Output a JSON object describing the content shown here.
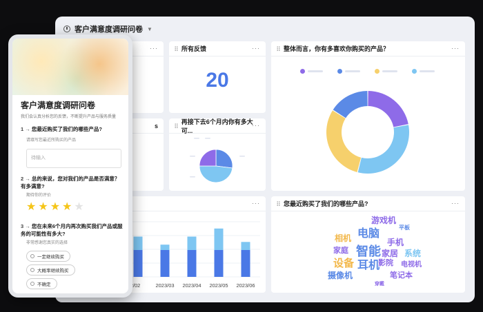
{
  "dashboard": {
    "title": "客户满意度调研问卷",
    "more_label": "···",
    "cards": {
      "partial_top": {
        "title": ""
      },
      "feedback": {
        "title": "所有反馈",
        "value": "20"
      },
      "donut": {
        "title": "整体而言，你有多喜欢你购买的产品？"
      },
      "partial_mid": {
        "title": "s"
      },
      "pie": {
        "title": "再接下去6个月内你有多大可..."
      },
      "bar_chart": {
        "title": ""
      },
      "wordcloud": {
        "title": "您最近购买了我们的哪些产品?"
      }
    }
  },
  "colors": {
    "purple": "#8e6be8",
    "blue": "#5b8ae6",
    "light_blue": "#7ec6f2",
    "yellow": "#f6d06c",
    "accent": "#4a78e6"
  },
  "chart_data": [
    {
      "type": "pie",
      "donut": true,
      "values": [
        22,
        32,
        30,
        16
      ],
      "colors": [
        "#8e6be8",
        "#7ec6f2",
        "#f6d06c",
        "#5b8ae6"
      ]
    },
    {
      "type": "pie",
      "values": [
        27,
        48,
        25
      ],
      "colors": [
        "#5b8ae6",
        "#7ec6f2",
        "#8e6be8"
      ]
    },
    {
      "type": "bar",
      "stacked": true,
      "categories": [
        "2022/02",
        "2023/03",
        "2023/04",
        "2023/05",
        "2023/06"
      ],
      "category_labels": [
        "2/02",
        "2023/03",
        "2023/04",
        "2023/05",
        "2023/06"
      ],
      "series": [
        {
          "values": [
            10,
            10,
            10,
            10,
            10
          ]
        },
        {
          "values": [
            5,
            2,
            5,
            8,
            3
          ]
        }
      ],
      "ylim": [
        0,
        20
      ]
    }
  ],
  "wordcloud": [
    {
      "text": "游戏机",
      "color": "#8e6be8",
      "size": 12
    },
    {
      "text": "电脑",
      "color": "#5b8ae6",
      "size": 16
    },
    {
      "text": "平板",
      "color": "#5b8ae6",
      "size": 8
    },
    {
      "text": "相机",
      "color": "#f2b84b",
      "size": 12
    },
    {
      "text": "家庭",
      "color": "#8e6be8",
      "size": 11
    },
    {
      "text": "手机",
      "color": "#8e6be8",
      "size": 12
    },
    {
      "text": "智能",
      "color": "#5b8ae6",
      "size": 18
    },
    {
      "text": "家居",
      "color": "#8e6be8",
      "size": 12
    },
    {
      "text": "系统",
      "color": "#7ec6f2",
      "size": 12
    },
    {
      "text": "设备",
      "color": "#f2b84b",
      "size": 15
    },
    {
      "text": "影院",
      "color": "#8e6be8",
      "size": 11
    },
    {
      "text": "电视机",
      "color": "#8e6be8",
      "size": 10
    },
    {
      "text": "耳机",
      "color": "#5b8ae6",
      "size": 16
    },
    {
      "text": "摄像机",
      "color": "#5b8ae6",
      "size": 12
    },
    {
      "text": "笔记本",
      "color": "#8e6be8",
      "size": 11
    },
    {
      "text": "穿戴",
      "color": "#8e6be8",
      "size": 7
    }
  ],
  "phone": {
    "title": "客户满意度调研问卷",
    "subtitle": "我们会认真分析您的反馈，不断提升产品与服务质量",
    "q1": {
      "num": "1 →",
      "text": "您最近购买了我们的哪些产品?",
      "hint": "请填写您最近所购买的产品",
      "placeholder": "待输入"
    },
    "q2": {
      "num": "2 →",
      "text": "总的来说，您对我们的产品是否满意？有多满意?",
      "hint": "期待你的评价",
      "rating": 4,
      "max": 5
    },
    "q3": {
      "num": "3 →",
      "text": "您在未来6个月内再次购买我们产品或服务的可能性有多大?",
      "hint": "非常感谢您真实的选择",
      "options": [
        "一定继续购买",
        "大概率继续购买",
        "不确定"
      ]
    }
  }
}
